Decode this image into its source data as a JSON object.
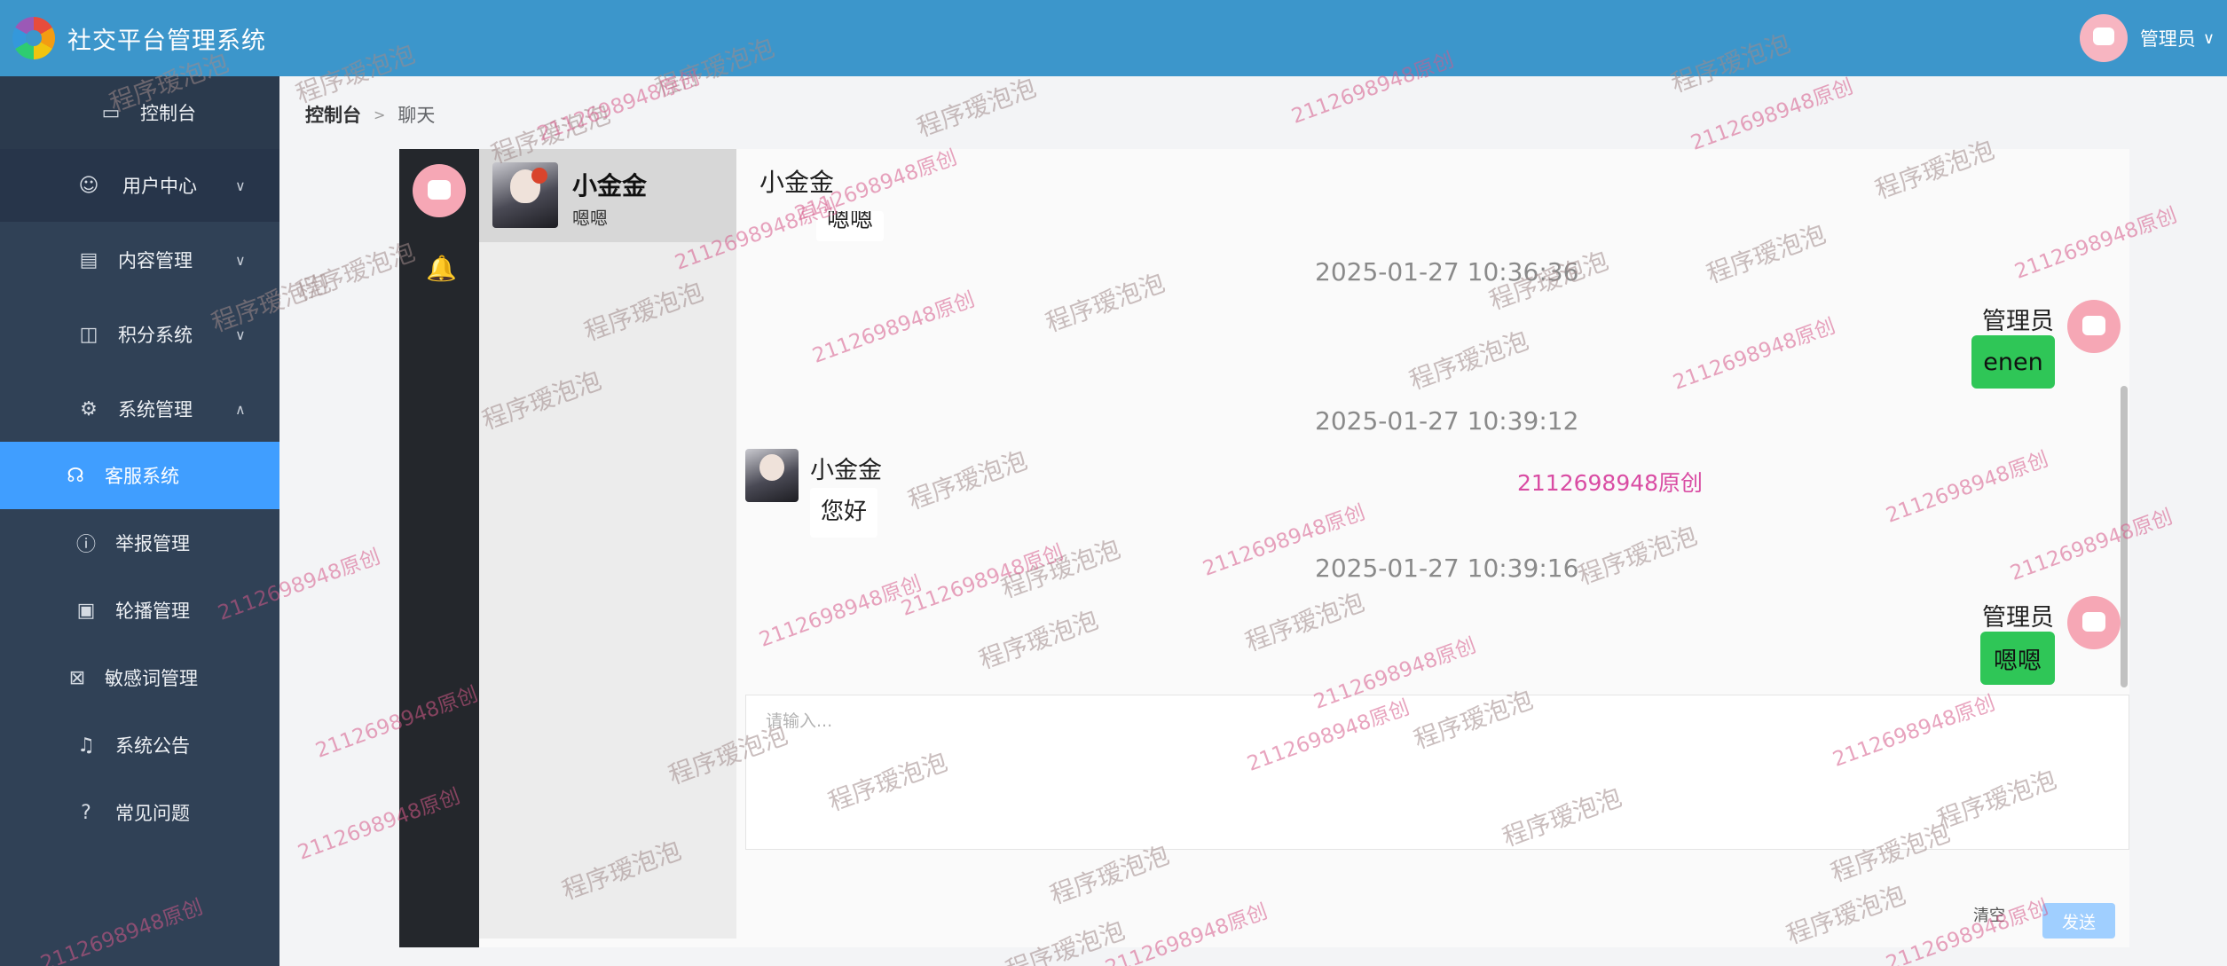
{
  "app": {
    "title": "社交平台管理系统"
  },
  "header": {
    "user_name": "管理员",
    "caret": "∨"
  },
  "sidebar": {
    "items": [
      {
        "label": "控制台",
        "icon": "monitor-icon",
        "glyph": "▭"
      },
      {
        "label": "用户中心",
        "icon": "user-icon",
        "glyph": "☺",
        "arrow": "∨"
      },
      {
        "label": "内容管理",
        "icon": "document-icon",
        "glyph": "▤",
        "arrow": "∨"
      },
      {
        "label": "积分系统",
        "icon": "cup-icon",
        "glyph": "◫",
        "arrow": "∨"
      },
      {
        "label": "系统管理",
        "icon": "gear-icon",
        "glyph": "⚙",
        "arrow": "∧"
      },
      {
        "label": "客服系统",
        "icon": "headset-icon",
        "glyph": "☊"
      },
      {
        "label": "举报管理",
        "icon": "warning-icon",
        "glyph": "ⓘ"
      },
      {
        "label": "轮播管理",
        "icon": "picture-icon",
        "glyph": "▣"
      },
      {
        "label": "敏感词管理",
        "icon": "file-x-icon",
        "glyph": "⊠"
      },
      {
        "label": "系统公告",
        "icon": "bell-icon",
        "glyph": "♫"
      },
      {
        "label": "常见问题",
        "icon": "question-icon",
        "glyph": "?"
      }
    ]
  },
  "breadcrumb": {
    "home": "控制台",
    "separator": ">",
    "current": "聊天"
  },
  "chat": {
    "left_bar": {
      "bell_glyph": "🔔"
    },
    "contacts": [
      {
        "name": "小金金",
        "last_message": "嗯嗯"
      }
    ],
    "title": "小金金",
    "prev_bubble": "嗯嗯",
    "messages": [
      {
        "time": "2025-01-27 10:36:36",
        "sender": "管理员",
        "text": "enen",
        "side": "right"
      },
      {
        "time": "2025-01-27 10:39:12",
        "sender": "小金金",
        "text": "您好",
        "side": "left"
      },
      {
        "time": "2025-01-27 10:39:16",
        "sender": "管理员",
        "text": "嗯嗯",
        "side": "right"
      }
    ],
    "input_placeholder": "请输入...",
    "clear_label": "清空",
    "send_label": "发送"
  },
  "watermark": {
    "text_a": "程序瑷泡泡",
    "text_b": "2112698948原创"
  },
  "colors": {
    "header": "#3c96cb",
    "sidebar": "#304156",
    "active": "#409eff",
    "bubble_green": "#2fc657",
    "send_disabled": "#a0cfff"
  }
}
